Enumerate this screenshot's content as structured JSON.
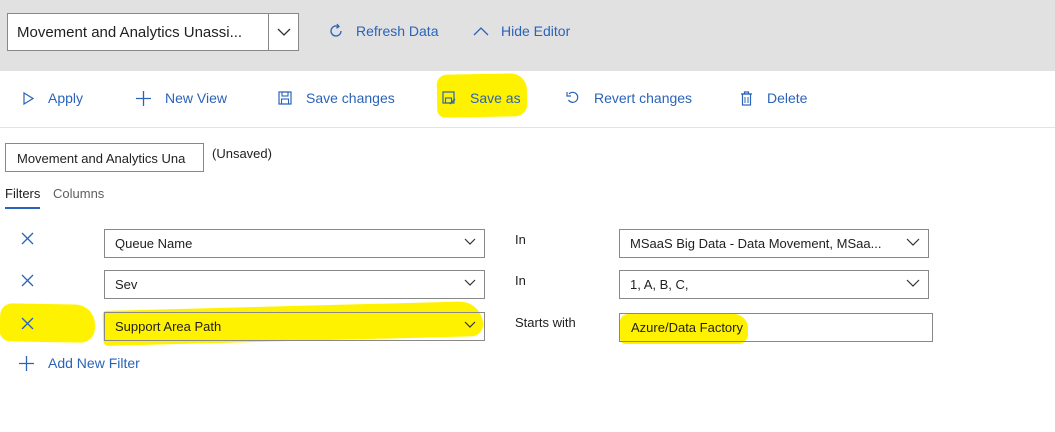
{
  "view_selector": {
    "value": "Movement and Analytics Unassi..."
  },
  "top_actions": {
    "refresh": "Refresh Data",
    "hide_editor": "Hide Editor"
  },
  "command_bar": {
    "apply": "Apply",
    "new_view": "New View",
    "save_changes": "Save changes",
    "save_as": "Save as",
    "revert_changes": "Revert changes",
    "delete": "Delete"
  },
  "editor": {
    "view_name": "Movement and Analytics Una",
    "status": "(Unsaved)",
    "tabs": {
      "filters": "Filters",
      "columns": "Columns"
    }
  },
  "filters": [
    {
      "field": "Queue Name",
      "operator": "In",
      "value": "MSaaS Big Data - Data Movement, MSaa..."
    },
    {
      "field": "Sev",
      "operator": "In",
      "value": "1, A, B, C,"
    },
    {
      "field": "Support Area Path",
      "operator": "Starts with",
      "value": "Azure/Data Factory"
    }
  ],
  "add_filter": "Add New Filter",
  "colors": {
    "accent": "#2b63b8",
    "highlight": "#fff200",
    "topbar": "#e1e1e1"
  }
}
